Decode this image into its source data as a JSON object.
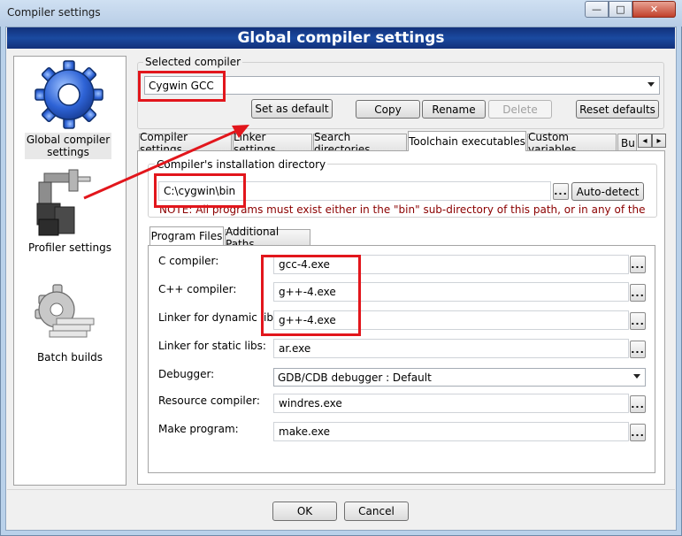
{
  "window": {
    "title": "Compiler settings",
    "minimize_glyph": "—",
    "maximize_glyph": "□",
    "close_glyph": "✕"
  },
  "banner": {
    "title": "Global compiler settings"
  },
  "sidebar": {
    "items": [
      {
        "label_line1": "Global compiler",
        "label_line2": "settings",
        "icon": "gear-icon"
      },
      {
        "label": "Profiler settings",
        "icon": "profiler-icon"
      },
      {
        "label": "Batch builds",
        "icon": "batch-builds-icon"
      }
    ]
  },
  "selected_compiler": {
    "group_label": "Selected compiler",
    "value": "Cygwin GCC"
  },
  "compiler_buttons": {
    "set_default": "Set as default",
    "copy": "Copy",
    "rename": "Rename",
    "delete": "Delete",
    "reset_defaults": "Reset defaults"
  },
  "tabs": [
    {
      "label": "Compiler settings"
    },
    {
      "label": "Linker settings"
    },
    {
      "label": "Search directories"
    },
    {
      "label": "Toolchain executables",
      "active": true
    },
    {
      "label": "Custom variables"
    },
    {
      "label": "Bui"
    }
  ],
  "tab_scroll": {
    "left": "◂",
    "right": "▸"
  },
  "install_dir": {
    "group_label": "Compiler's installation directory",
    "value": "C:\\cygwin\\bin",
    "browse": "...",
    "auto_detect": "Auto-detect",
    "note": "NOTE: All programs must exist either in the \"bin\" sub-directory of this path, or in any of the"
  },
  "subtabs": [
    {
      "label": "Program Files",
      "active": true
    },
    {
      "label": "Additional Paths"
    }
  ],
  "programs": {
    "c_compiler": {
      "label": "C compiler:",
      "value": "gcc-4.exe"
    },
    "cpp_compiler": {
      "label": "C++ compiler:",
      "value": "g++-4.exe"
    },
    "linker_dynamic": {
      "label": "Linker for dynamic libs:",
      "value": "g++-4.exe"
    },
    "linker_static": {
      "label": "Linker for static libs:",
      "value": "ar.exe"
    },
    "debugger": {
      "label": "Debugger:",
      "value": "GDB/CDB debugger : Default"
    },
    "resource_compiler": {
      "label": "Resource compiler:",
      "value": "windres.exe"
    },
    "make_program": {
      "label": "Make program:",
      "value": "make.exe"
    },
    "browse": "..."
  },
  "footer": {
    "ok": "OK",
    "cancel": "Cancel"
  },
  "colors": {
    "banner": "#1a4aa0",
    "annotation_red": "#e2161c",
    "note_text": "#8b0000"
  }
}
